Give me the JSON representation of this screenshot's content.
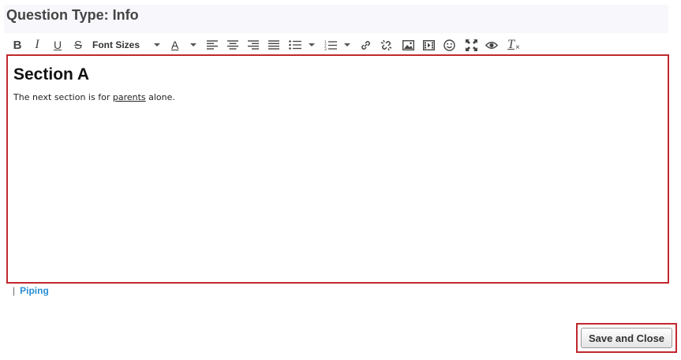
{
  "header": {
    "title": "Question Type: Info"
  },
  "toolbar": {
    "bold": "B",
    "italic": "I",
    "underline": "U",
    "strike": "S",
    "font_sizes_label": "Font Sizes",
    "font_color": "A",
    "clear_format": "T",
    "icons": [
      "bold-icon",
      "italic-icon",
      "underline-icon",
      "strikethrough-icon",
      "font-sizes-dropdown",
      "font-color-icon",
      "align-left-icon",
      "align-center-icon",
      "align-right-icon",
      "align-justify-icon",
      "bullet-list-icon",
      "numbered-list-icon",
      "link-icon",
      "unlink-icon",
      "image-icon",
      "video-icon",
      "emoticon-icon",
      "fullscreen-icon",
      "preview-icon",
      "clear-format-icon"
    ]
  },
  "editor": {
    "heading": "Section A",
    "paragraph_before": "The next section is for ",
    "paragraph_link": "parents",
    "paragraph_after": " alone."
  },
  "footer": {
    "separator": "|",
    "piping_label": "Piping",
    "save_label": "Save and Close"
  },
  "colors": {
    "highlight_border": "#c0282d",
    "link": "#2a8fd6"
  }
}
